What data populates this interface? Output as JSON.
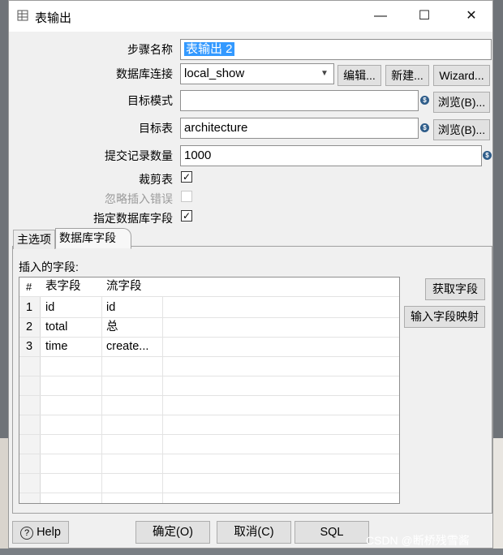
{
  "window": {
    "title": "表输出",
    "minimize_glyph": "—",
    "maximize_glyph": "☐",
    "close_glyph": "✕"
  },
  "form": {
    "step_name_label": "步骤名称",
    "step_name_value": "表输出 2",
    "db_conn_label": "数据库连接",
    "db_conn_value": "local_show",
    "edit_button": "编辑...",
    "new_button": "新建...",
    "wizard_button": "Wizard...",
    "target_schema_label": "目标模式",
    "target_schema_value": "",
    "browse_button_1": "浏览(B)...",
    "target_table_label": "目标表",
    "target_table_value": "architecture",
    "browse_button_2": "浏览(B)...",
    "commit_size_label": "提交记录数量",
    "commit_size_value": "1000",
    "truncate_label": "裁剪表",
    "truncate_checked": "✓",
    "ignore_errors_label": "忽略插入错误",
    "specify_fields_label": "指定数据库字段",
    "specify_fields_checked": "✓",
    "variable_icon_glyph": "$"
  },
  "tabs": [
    {
      "label": "主选项"
    },
    {
      "label": "数据库字段"
    }
  ],
  "fields_panel": {
    "label": "插入的字段:",
    "columns": {
      "num": "#",
      "table_field": "表字段",
      "stream_field": "流字段"
    },
    "rows": [
      {
        "num": "1",
        "table_field": "id",
        "stream_field": "id"
      },
      {
        "num": "2",
        "table_field": "total",
        "stream_field": "总"
      },
      {
        "num": "3",
        "table_field": "time",
        "stream_field": "create..."
      }
    ],
    "get_fields_button": "获取字段",
    "map_fields_button": "输入字段映射"
  },
  "footer": {
    "help_button": "Help",
    "help_icon": "?",
    "ok_button": "确定(O)",
    "cancel_button": "取消(C)",
    "sql_button": "SQL"
  },
  "watermark": "CSDN @断桥残雪酱"
}
